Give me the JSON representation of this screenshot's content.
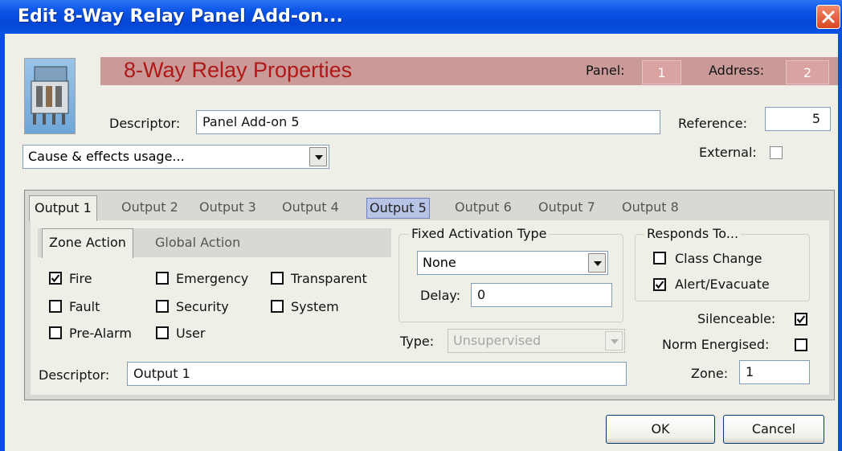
{
  "window": {
    "title": "Edit 8-Way Relay Panel Add-on..."
  },
  "header": {
    "title": "8-Way Relay Properties",
    "panel_label": "Panel:",
    "panel_value": "1",
    "address_label": "Address:",
    "address_value": "2",
    "band_color": "#c99a98",
    "title_color": "#b01818"
  },
  "descriptor": {
    "label": "Descriptor:",
    "value": "Panel Add-on 5"
  },
  "reference": {
    "label": "Reference:",
    "value": "5"
  },
  "external": {
    "label": "External:",
    "checked": false
  },
  "cause_effects": {
    "value": "Cause & effects usage..."
  },
  "tabs": [
    {
      "label": "Output 1",
      "active": true
    },
    {
      "label": "Output 2"
    },
    {
      "label": "Output 3"
    },
    {
      "label": "Output 4"
    },
    {
      "label": "Output 5",
      "highlighted": true
    },
    {
      "label": "Output 6"
    },
    {
      "label": "Output 7"
    },
    {
      "label": "Output 8"
    }
  ],
  "subtabs": [
    {
      "label": "Zone Action",
      "active": true
    },
    {
      "label": "Global Action"
    }
  ],
  "zone_actions": [
    {
      "label": "Fire",
      "checked": true
    },
    {
      "label": "Emergency",
      "checked": false
    },
    {
      "label": "Transparent",
      "checked": false
    },
    {
      "label": "Fault",
      "checked": false
    },
    {
      "label": "Security",
      "checked": false
    },
    {
      "label": "System",
      "checked": false
    },
    {
      "label": "Pre-Alarm",
      "checked": false
    },
    {
      "label": "User",
      "checked": false
    }
  ],
  "fixed_activation": {
    "title": "Fixed Activation Type",
    "value": "None",
    "delay_label": "Delay:",
    "delay_value": "0"
  },
  "type": {
    "label": "Type:",
    "value": "Unsupervised",
    "disabled": true
  },
  "responds_to": {
    "title": "Responds To...",
    "items": [
      {
        "label": "Class Change",
        "checked": false
      },
      {
        "label": "Alert/Evacuate",
        "checked": true
      }
    ]
  },
  "silenceable": {
    "label": "Silenceable:",
    "checked": true
  },
  "norm_energised": {
    "label": "Norm Energised:",
    "checked": false
  },
  "zone": {
    "label": "Zone:",
    "value": "1"
  },
  "output_descriptor": {
    "label": "Descriptor:",
    "value": "Output 1"
  },
  "buttons": {
    "ok": "OK",
    "cancel": "Cancel"
  },
  "icons": {
    "close": "close-icon",
    "relay": "relay-image",
    "dropdown": "chevron-down-icon",
    "check": "checkmark-icon"
  }
}
